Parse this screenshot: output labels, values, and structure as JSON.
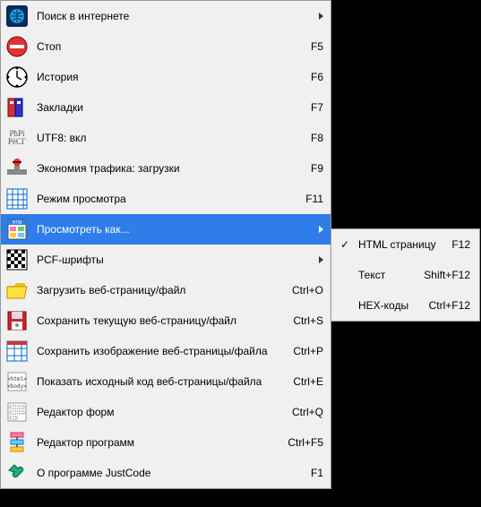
{
  "menu": {
    "items": [
      {
        "label": "Поиск в интернете",
        "shortcut": "",
        "arrow": true
      },
      {
        "label": "Стоп",
        "shortcut": "F5"
      },
      {
        "label": "История",
        "shortcut": "F6"
      },
      {
        "label": "Закладки",
        "shortcut": "F7"
      },
      {
        "label": "UTF8: вкл",
        "shortcut": "F8"
      },
      {
        "label": "Экономия трафика: загрузки",
        "shortcut": "F9"
      },
      {
        "label": "Режим просмотра",
        "shortcut": "F11"
      },
      {
        "label": "Просмотреть как...",
        "shortcut": "",
        "arrow": true,
        "highlighted": true
      },
      {
        "label": "PCF-шрифты",
        "shortcut": "",
        "arrow": true
      },
      {
        "label": "Загрузить веб-страницу/файл",
        "shortcut": "Ctrl+O"
      },
      {
        "label": "Сохранить текущую веб-страницу/файл",
        "shortcut": "Ctrl+S"
      },
      {
        "label": "Сохранить изображение веб-страницы/файла",
        "shortcut": "Ctrl+P"
      },
      {
        "label": "Показать исходный код веб-страницы/файла",
        "shortcut": "Ctrl+E"
      },
      {
        "label": "Редактор форм",
        "shortcut": "Ctrl+Q"
      },
      {
        "label": "Редактор программ",
        "shortcut": "Ctrl+F5"
      },
      {
        "label": "О программе JustCode",
        "shortcut": "F1"
      }
    ]
  },
  "submenu": {
    "items": [
      {
        "label": "HTML страницу",
        "shortcut": "F12",
        "checked": true
      },
      {
        "label": "Текст",
        "shortcut": "Shift+F12",
        "checked": false
      },
      {
        "label": "HEX-коды",
        "shortcut": "Ctrl+F12",
        "checked": false
      }
    ]
  },
  "icon_text": {
    "utf8_top": "PħPï",
    "utf8_bot": "PëCΓ"
  }
}
